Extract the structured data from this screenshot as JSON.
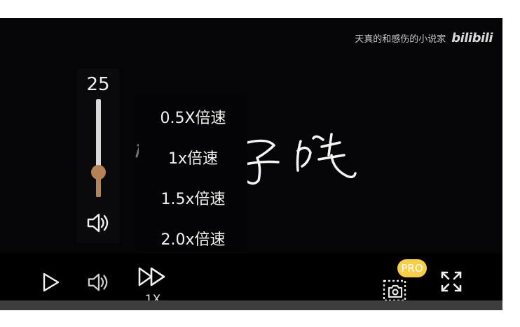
{
  "watermark": {
    "channel": "天真的和感伤的小说家",
    "logo": "bilibili"
  },
  "volume": {
    "value": "25",
    "level": 0.25
  },
  "speed_menu": {
    "options": [
      "0.5X倍速",
      "1x倍速",
      "1.5x倍速",
      "2.0x倍速"
    ]
  },
  "controls": {
    "speed_label": "1X",
    "pro_badge": "PRO"
  },
  "colors": {
    "accent": "#b48356",
    "pro_badge": "#f7ce49",
    "background": "#050507"
  },
  "icons": {
    "play": "play-icon",
    "volume": "volume-icon",
    "fast_forward": "fast-forward-icon",
    "screenshot": "screenshot-icon",
    "fullscreen": "fullscreen-icon"
  }
}
